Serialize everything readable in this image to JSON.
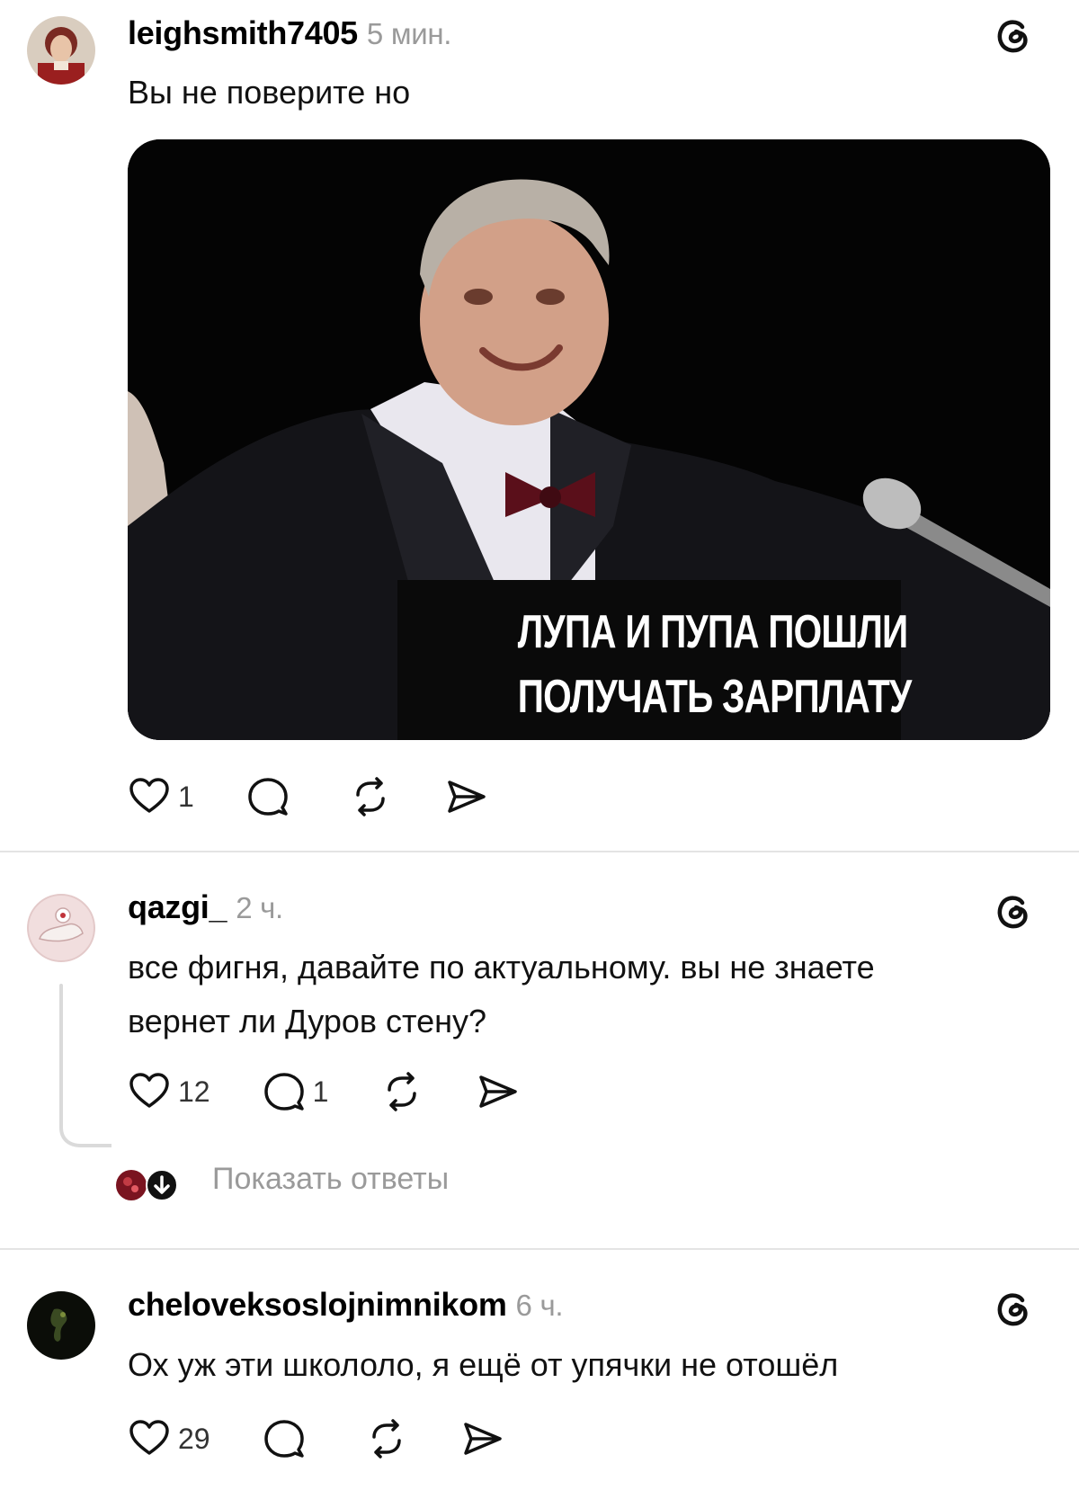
{
  "posts": [
    {
      "username": "leighsmith7405",
      "time": "5 мин.",
      "text": "Вы не поверите но",
      "image": {
        "caption_line1": "ЛУПА И ПУПА ПОШЛИ",
        "caption_line2": "ПОЛУЧАТЬ ЗАРПЛАТУ"
      },
      "likes": "1",
      "replies": ""
    },
    {
      "username": "qazgi_",
      "time": "2 ч.",
      "text_line1": "все фигня, давайте по актуальному. вы не знаете",
      "text_line2": "вернет ли Дуров стену?",
      "likes": "12",
      "replies": "1",
      "show_replies": "Показать ответы"
    },
    {
      "username": "cheloveksoslojnimnikom",
      "time": "6 ч.",
      "text": "Ох уж эти школоло, я ещё от упячки не отошёл",
      "likes": "29",
      "replies": ""
    }
  ],
  "icons": {
    "like": "heart-icon",
    "reply": "comment-icon",
    "repost": "repost-icon",
    "share": "share-icon",
    "app": "threads-icon"
  }
}
